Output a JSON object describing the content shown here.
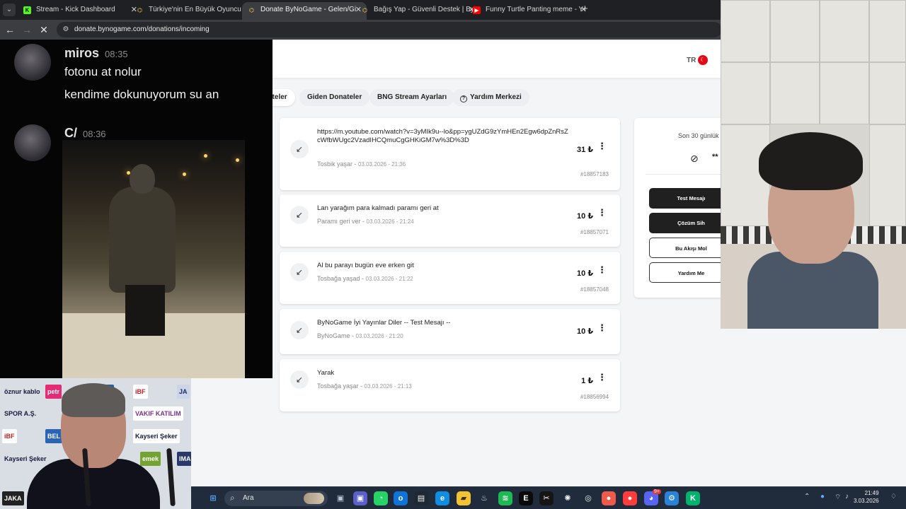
{
  "browser": {
    "tabs": [
      {
        "title": "Stream - Kick Dashboard",
        "fav_color": "#53fc18",
        "fav_text": "K"
      },
      {
        "title": "Türkiye'nin En Büyük Oyuncu D",
        "fav_color": "#f5c542",
        "fav_text": "⌬"
      },
      {
        "title": "Donate ByNoGame - Gelen/Gi",
        "fav_color": "#f5c542",
        "fav_text": "⌬"
      },
      {
        "title": "Bağış Yap - Güvenli Destek | By",
        "fav_color": "#f5c542",
        "fav_text": "⌬"
      },
      {
        "title": "Funny Turtle Panting meme - Y",
        "fav_color": "#ff0000",
        "fav_text": "▶"
      }
    ],
    "url": "donate.bynogame.com/donations/incoming"
  },
  "header": {
    "language": "TR"
  },
  "nav": {
    "incoming": "ateler",
    "outgoing": "Giden Donateler",
    "stream_settings": "BNG Stream Ayarları",
    "help_center": "Yardım Merkezi"
  },
  "donations": [
    {
      "message": "https://m.youtube.com/watch?v=3yMIk9u--lo&pp=ygUZdG9zYmHEn2Egw6dpZnRsZcWfbWUgc2VzadIHCQmuCgGHKiGM7w%3D%3D",
      "sender": "Tosbik yaşar",
      "date": "03.03.2026 - 21:36",
      "amount": "31 ₺",
      "id": "#18857183"
    },
    {
      "message": "Lan yarağım para kalmadı paramı geri at",
      "sender": "Paramı geri ver",
      "date": "03.03.2026 - 21:24",
      "amount": "10 ₺",
      "id": "#18857071"
    },
    {
      "message": "Al bu parayı bugün eve erken git",
      "sender": "Tosbağa yaşad",
      "date": "03.03.2026 - 21:22",
      "amount": "10 ₺",
      "id": "#18857048"
    },
    {
      "message": "ByNoGame İyi Yayınlar Diler -- Test Mesajı --",
      "sender": "ByNoGame",
      "date": "03.03.2026 - 21:20",
      "amount": "10 ₺",
      "id": ""
    },
    {
      "message": "Yarak",
      "sender": "Tosbağa yaşar",
      "date": "03.03.2026 - 21:13",
      "amount": "1 ₺",
      "id": "#18856994"
    }
  ],
  "sidebar": {
    "stats_label": "Son 30 günlük",
    "stats_value": "**",
    "buttons": [
      "Test Mesajı",
      "Çözüm Sih",
      "Bu Akışı Mol",
      "Yardım Me"
    ]
  },
  "chat": {
    "messages": [
      {
        "user": "miros",
        "time": "08:35",
        "lines": [
          "fotonu at nolur",
          "kendime dokunuyorum su an"
        ]
      },
      {
        "user": "C/",
        "time": "08:36",
        "lines": []
      }
    ]
  },
  "sponsors": [
    {
      "text": "öznur kablo",
      "color": "#151a3d"
    },
    {
      "text": "petr",
      "color": "#ffffff"
    },
    {
      "text": "oy",
      "color": "#ffffff"
    },
    {
      "text": "iBF",
      "color": "#c81d25"
    },
    {
      "text": "JA",
      "color": "#1c2c68"
    },
    {
      "text": "SPOR A.Ş.",
      "color": "#151a3d"
    },
    {
      "text": "VAKIF KATILIM",
      "color": "#7b2f88"
    },
    {
      "text": "iBF",
      "color": "#c81d25"
    },
    {
      "text": "BEL",
      "color": "#ffffff"
    },
    {
      "text": "Kayseri Şeker",
      "color": "#151a3d"
    },
    {
      "text": "Kayseri Şeker",
      "color": "#151a3d"
    },
    {
      "text": "emek",
      "color": "#ffffff"
    },
    {
      "text": "IMA",
      "color": "#ffffff"
    },
    {
      "text": "JAKA",
      "color": "#ffffff"
    }
  ],
  "taskbar": {
    "search": "Ara",
    "time": "21:49",
    "date": "3.03.2026",
    "discord_badge": "9+"
  }
}
